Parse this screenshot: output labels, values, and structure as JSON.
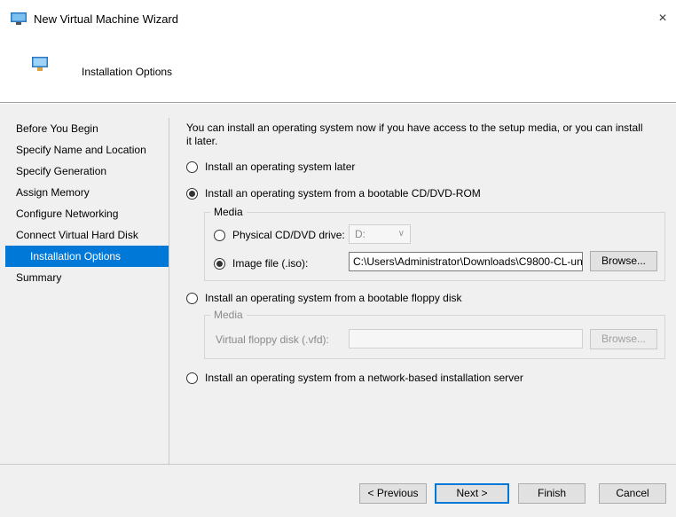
{
  "window": {
    "title": "New Virtual Machine Wizard",
    "close": "×"
  },
  "header": {
    "title": "Installation Options"
  },
  "nav": {
    "items": [
      {
        "label": "Before You Begin"
      },
      {
        "label": "Specify Name and Location"
      },
      {
        "label": "Specify Generation"
      },
      {
        "label": "Assign Memory"
      },
      {
        "label": "Configure Networking"
      },
      {
        "label": "Connect Virtual Hard Disk"
      },
      {
        "label": "Installation Options",
        "active": true
      },
      {
        "label": "Summary"
      }
    ]
  },
  "content": {
    "intro": "You can install an operating system now if you have access to the setup media, or you can install it later.",
    "opt_later": "Install an operating system later",
    "opt_cd": "Install an operating system from a bootable CD/DVD-ROM",
    "media_label": "Media",
    "physical_label": "Physical CD/DVD drive:",
    "physical_value": "D:",
    "image_label": "Image file (.iso):",
    "image_value": "C:\\Users\\Administrator\\Downloads\\C9800-CL-uni",
    "browse": "Browse...",
    "opt_floppy": "Install an operating system from a bootable floppy disk",
    "floppy_media_label": "Media",
    "floppy_label": "Virtual floppy disk (.vfd):",
    "floppy_browse": "Browse...",
    "opt_network": "Install an operating system from a network-based installation server"
  },
  "footer": {
    "previous": "< Previous",
    "next": "Next >",
    "finish": "Finish",
    "cancel": "Cancel"
  },
  "colors": {
    "accent": "#0078d7",
    "background": "#f0f0f0"
  }
}
